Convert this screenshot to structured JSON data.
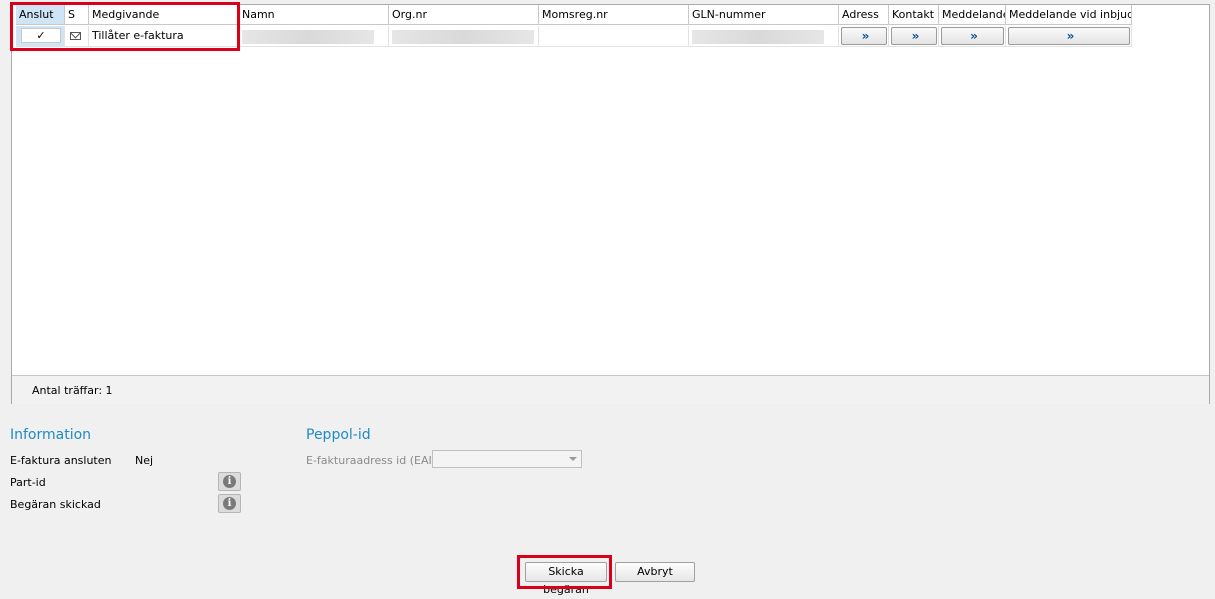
{
  "grid": {
    "columns": [
      "Anslut",
      "S",
      "Medgivande",
      "Namn",
      "Org.nr",
      "Momsreg.nr",
      "GLN-nummer",
      "Adress",
      "Kontakt",
      "Meddelande",
      "Meddelande vid inbjudan"
    ],
    "row": {
      "anslut_checked": "✓",
      "medgivande": "Tillåter e-faktura",
      "arrow": "»"
    },
    "footer_label": "Antal träffar: 1"
  },
  "information": {
    "title": "Information",
    "ansluten_label": "E-faktura ansluten",
    "ansluten_value": "Nej",
    "partid_label": "Part-id",
    "begaran_label": "Begäran skickad",
    "info_glyph": "i"
  },
  "peppol": {
    "title": "Peppol-id",
    "eaid_label": "E-fakturaadress id (EAID)",
    "eaid_value": ""
  },
  "buttons": {
    "send": "Skicka begäran",
    "cancel": "Avbryt"
  },
  "colors": {
    "accent": "#1e8bc3",
    "highlight": "#d9001b",
    "selected_header": "#cfe5f5"
  }
}
